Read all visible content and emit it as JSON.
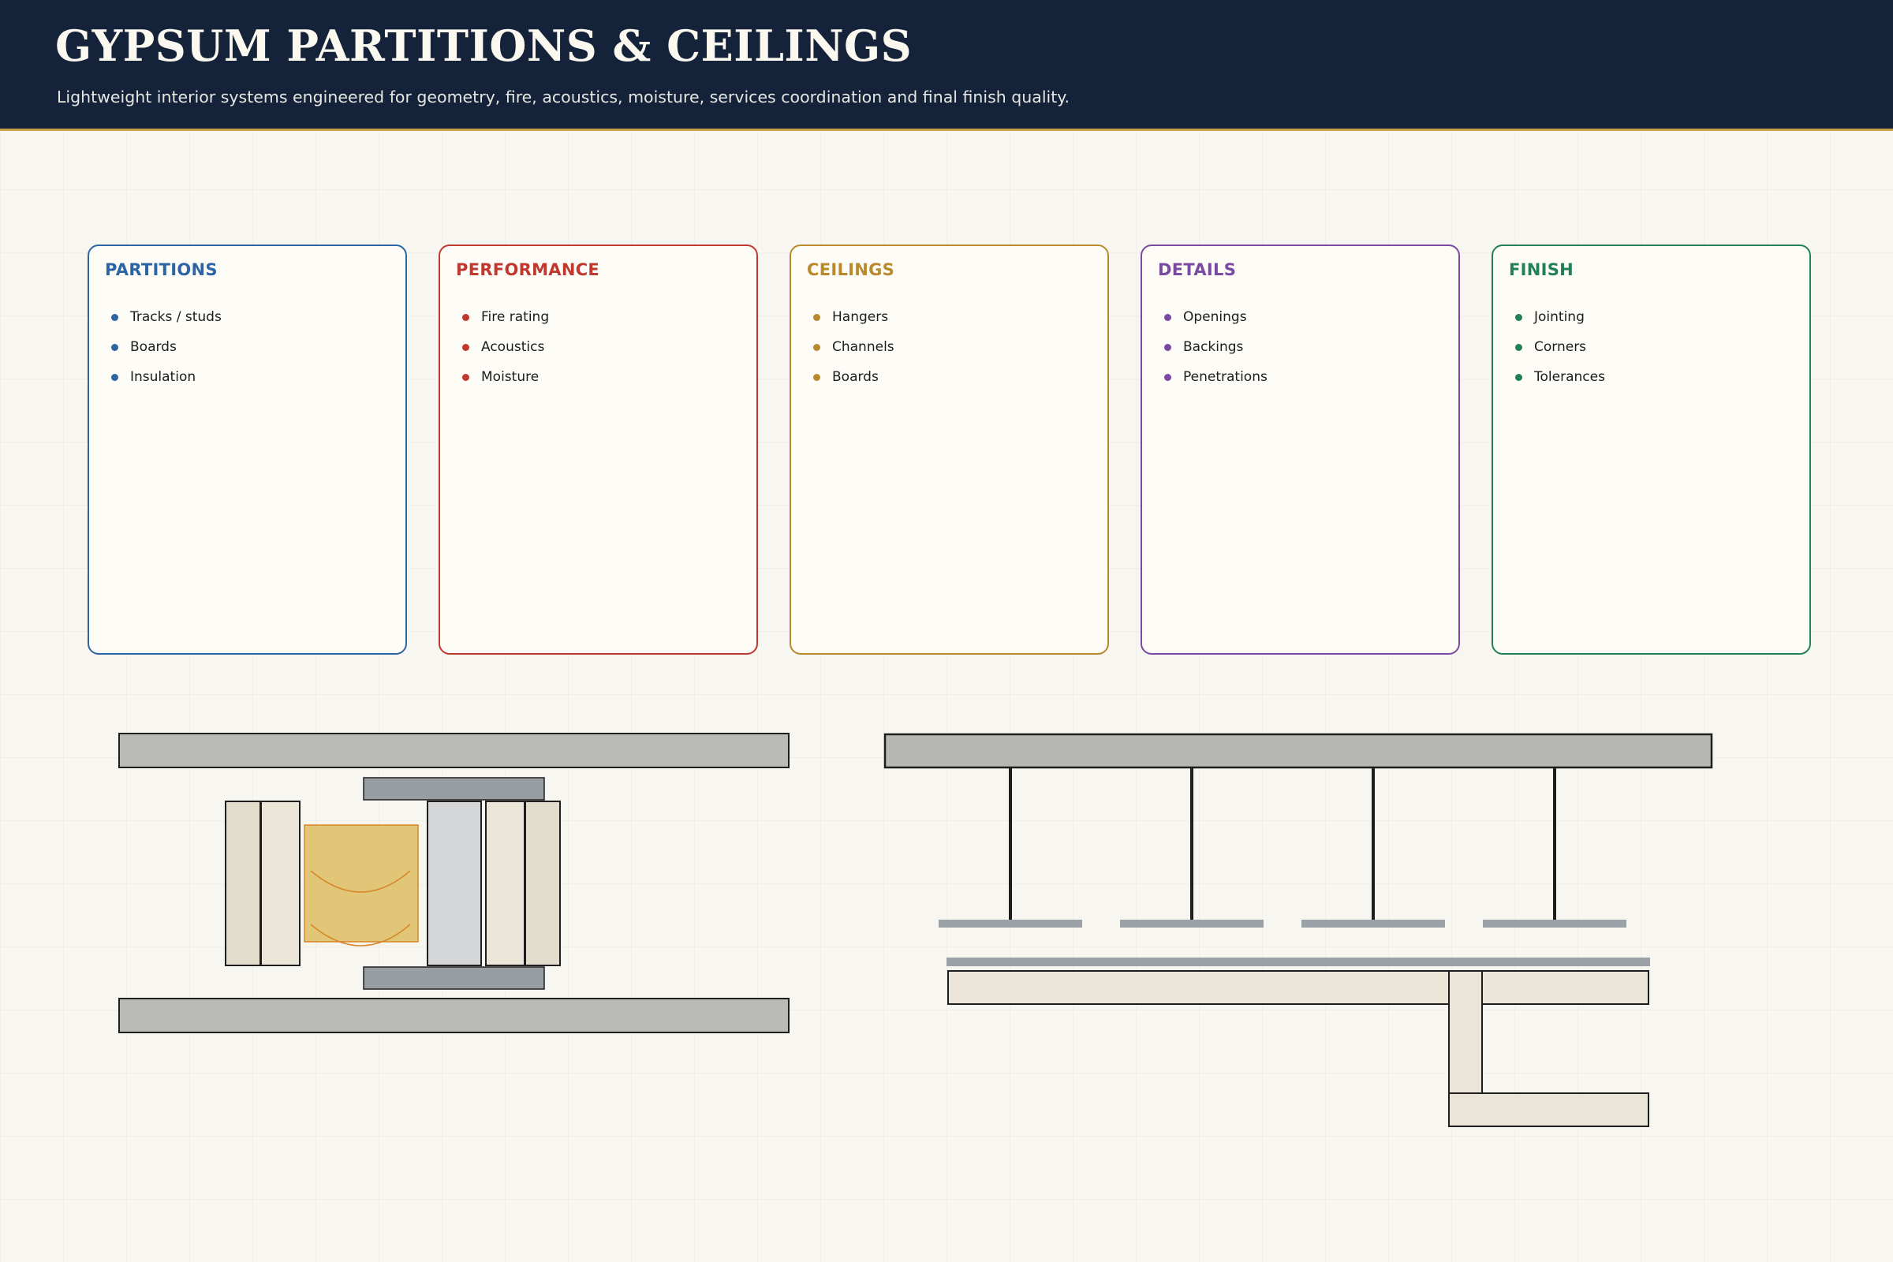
{
  "header": {
    "title": "GYPSUM PARTITIONS & CEILINGS",
    "subtitle": "Lightweight interior systems engineered for geometry, fire, acoustics, moisture, services coordination and final finish quality."
  },
  "cards": [
    {
      "title": "PARTITIONS",
      "color": "#2d64a4",
      "items": [
        "Tracks / studs",
        "Boards",
        "Insulation"
      ]
    },
    {
      "title": "PERFORMANCE",
      "color": "#c0392f",
      "items": [
        "Fire rating",
        "Acoustics",
        "Moisture"
      ]
    },
    {
      "title": "CEILINGS",
      "color": "#b88a2b",
      "items": [
        "Hangers",
        "Channels",
        "Boards"
      ]
    },
    {
      "title": "DETAILS",
      "color": "#7a4aa3",
      "items": [
        "Openings",
        "Backings",
        "Penetrations"
      ]
    },
    {
      "title": "FINISH",
      "color": "#238056",
      "items": [
        "Jointing",
        "Corners",
        "Tolerances"
      ]
    }
  ],
  "diagram_colors": {
    "slab": "#b9bab5",
    "track": "#979ea3",
    "board": "#ebe5d7",
    "board_dark": "#e2dccd",
    "stud": "#d5d6d7",
    "insulation": "#e0c676",
    "insulation_stroke": "#d8862a",
    "hanger": "#1e1e1e",
    "channel": "#9aa2a7",
    "ceiling_slab": "#b6b6b4"
  }
}
